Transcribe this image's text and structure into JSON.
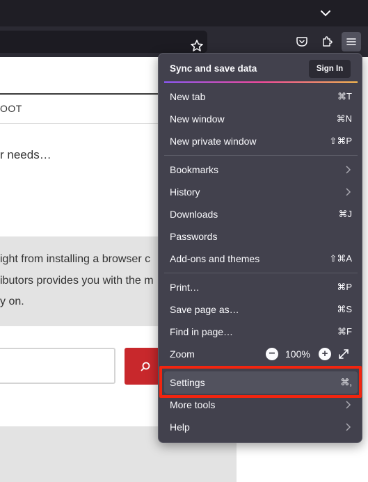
{
  "page": {
    "nav_text": "OOT",
    "intro_text": "r needs…",
    "band_lines": [
      "ight from installing a browser c",
      "ibutors provides you with the m",
      "y on."
    ]
  },
  "menu": {
    "sync_label": "Sync and save data",
    "sign_in_label": "Sign In",
    "items": [
      {
        "label": "New tab",
        "shortcut": "⌘T"
      },
      {
        "label": "New window",
        "shortcut": "⌘N"
      },
      {
        "label": "New private window",
        "shortcut": "⇧⌘P"
      },
      {
        "label": "Bookmarks",
        "submenu": true
      },
      {
        "label": "History",
        "submenu": true
      },
      {
        "label": "Downloads",
        "shortcut": "⌘J"
      },
      {
        "label": "Passwords"
      },
      {
        "label": "Add-ons and themes",
        "shortcut": "⇧⌘A"
      },
      {
        "label": "Print…",
        "shortcut": "⌘P"
      },
      {
        "label": "Save page as…",
        "shortcut": "⌘S"
      },
      {
        "label": "Find in page…",
        "shortcut": "⌘F"
      },
      {
        "label": "Zoom",
        "zoom_minus": "−",
        "zoom_value": "100%",
        "zoom_plus": "+"
      },
      {
        "label": "Settings",
        "shortcut": "⌘,"
      },
      {
        "label": "More tools",
        "submenu": true
      },
      {
        "label": "Help",
        "submenu": true
      }
    ]
  },
  "colors": {
    "menu_bg": "#42414d",
    "highlight": "#f2250f",
    "search_button": "#c8282c"
  },
  "icons": [
    "chevron-down-icon",
    "star-icon",
    "pocket-icon",
    "extensions-icon",
    "hamburger-menu-icon",
    "search-icon",
    "chevron-right-icon",
    "fullscreen-icon"
  ]
}
